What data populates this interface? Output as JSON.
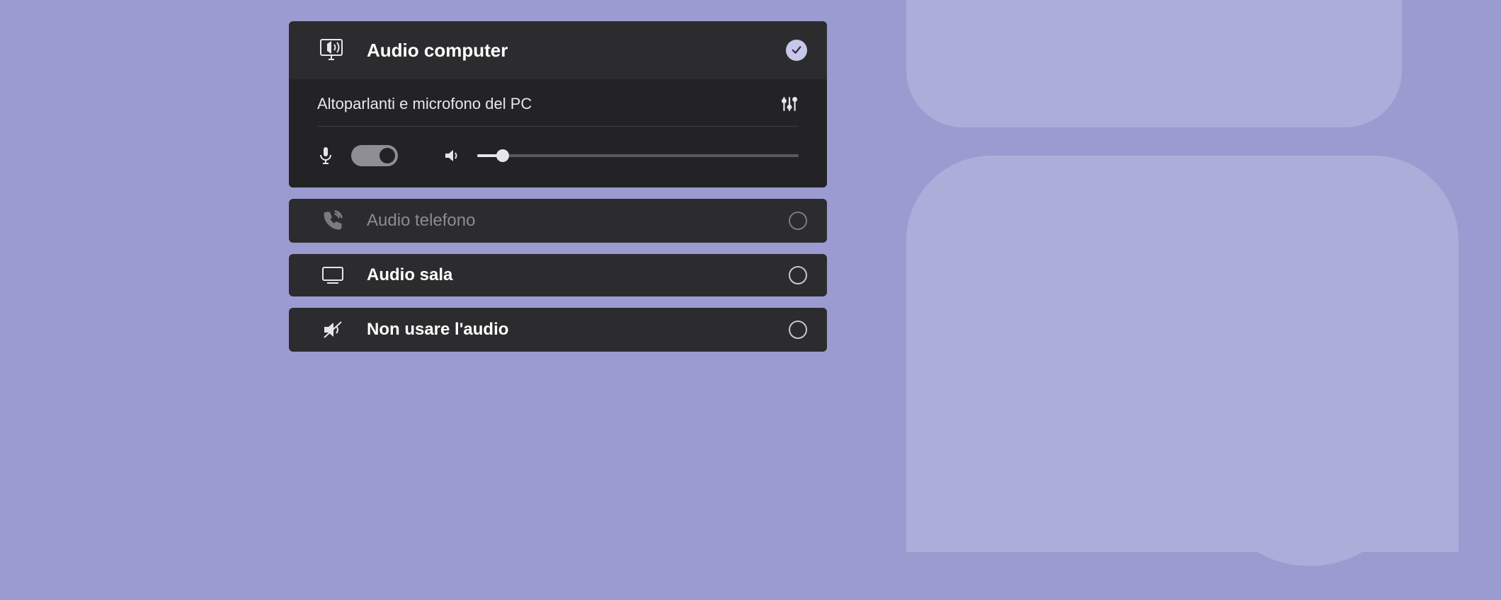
{
  "colors": {
    "bg": "#9b9bd1",
    "card": "#2c2c2e",
    "sub": "#232325",
    "accent": "#c7c7ea"
  },
  "options": {
    "computer": {
      "label": "Audio computer",
      "selected": true
    },
    "phone": {
      "label": "Audio telefono",
      "enabled": false
    },
    "room": {
      "label": "Audio sala"
    },
    "none": {
      "label": "Non usare l'audio"
    }
  },
  "device": {
    "name": "Altoparlanti e microfono del PC",
    "mic_on": true,
    "volume_percent": 8
  }
}
